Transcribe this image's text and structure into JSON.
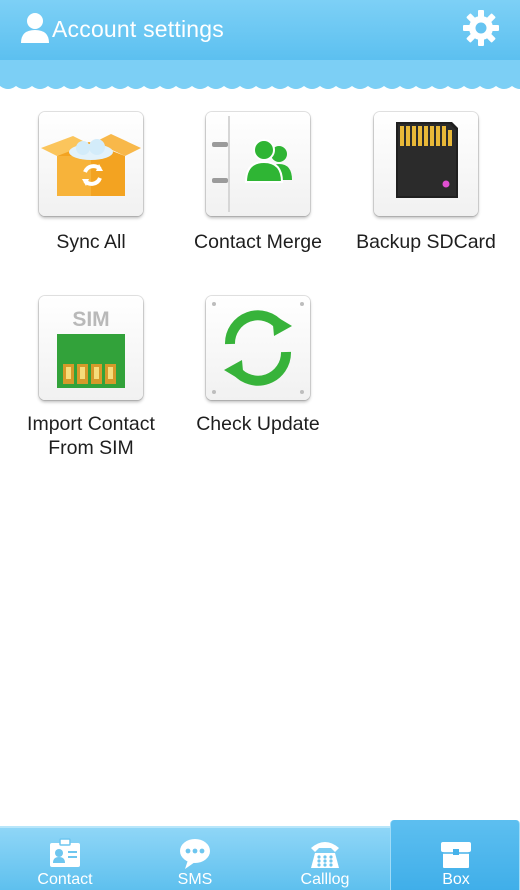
{
  "header": {
    "title": "Account settings",
    "user_icon": "user-icon",
    "settings_icon": "gear-icon"
  },
  "tiles": [
    {
      "label": "Sync All",
      "icon": "sync-box-icon"
    },
    {
      "label": "Contact Merge",
      "icon": "contact-merge-icon"
    },
    {
      "label": "Backup SDCard",
      "icon": "sd-card-icon"
    },
    {
      "label_line1": "Import Contact",
      "label_line2": "From SIM",
      "icon": "sim-card-icon"
    },
    {
      "label": "Check Update",
      "icon": "refresh-icon"
    }
  ],
  "nav": {
    "items": [
      {
        "label": "Contact",
        "icon": "contact-card-icon"
      },
      {
        "label": "SMS",
        "icon": "chat-bubble-icon"
      },
      {
        "label": "Calllog",
        "icon": "phone-icon"
      },
      {
        "label": "Box",
        "icon": "toolbox-icon",
        "active": true
      }
    ]
  },
  "colors": {
    "header_blue": "#5cc0f0",
    "nav_blue": "#5ec0ee",
    "active_tab": "#3faee9",
    "green_accent": "#2fb534",
    "orange_box": "#f6a623"
  }
}
